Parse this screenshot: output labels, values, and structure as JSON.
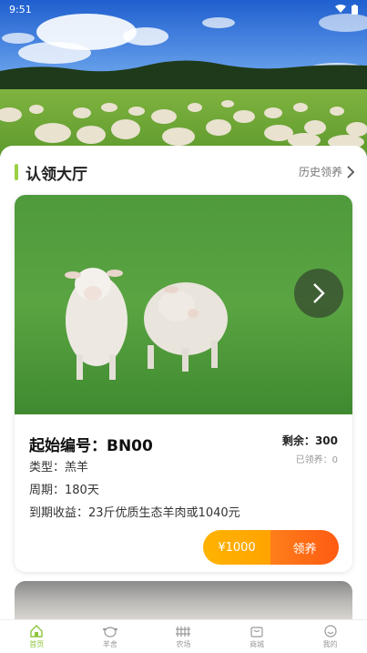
{
  "status_bar": {
    "time": "9:51"
  },
  "section": {
    "title": "认领大厅",
    "history_label": "历史领养"
  },
  "card": {
    "code_label": "起始编号：",
    "code_value": "BN00",
    "remaining_label": "剩余：",
    "remaining_value": "300",
    "adopted_label": "已领养：",
    "adopted_value": "0",
    "type_label": "类型：",
    "type_value": "羔羊",
    "cycle_label": "周期：",
    "cycle_value": "180天",
    "income_label": "到期收益：",
    "income_value": "23斤优质生态羊肉或1040元",
    "price_label": "¥1000",
    "adopt_label": "领养"
  },
  "tabs": [
    {
      "label": "首页",
      "icon": "home-icon",
      "active": true
    },
    {
      "label": "羊舍",
      "icon": "sheep-icon",
      "active": false
    },
    {
      "label": "农场",
      "icon": "fence-icon",
      "active": false
    },
    {
      "label": "商城",
      "icon": "shop-bag-icon",
      "active": false
    },
    {
      "label": "我的",
      "icon": "smiley-icon",
      "active": false
    }
  ],
  "colors": {
    "accent_green": "#8cc63e",
    "price_orange": "#ffaa00",
    "adopt_orange": "#ff6a14"
  }
}
